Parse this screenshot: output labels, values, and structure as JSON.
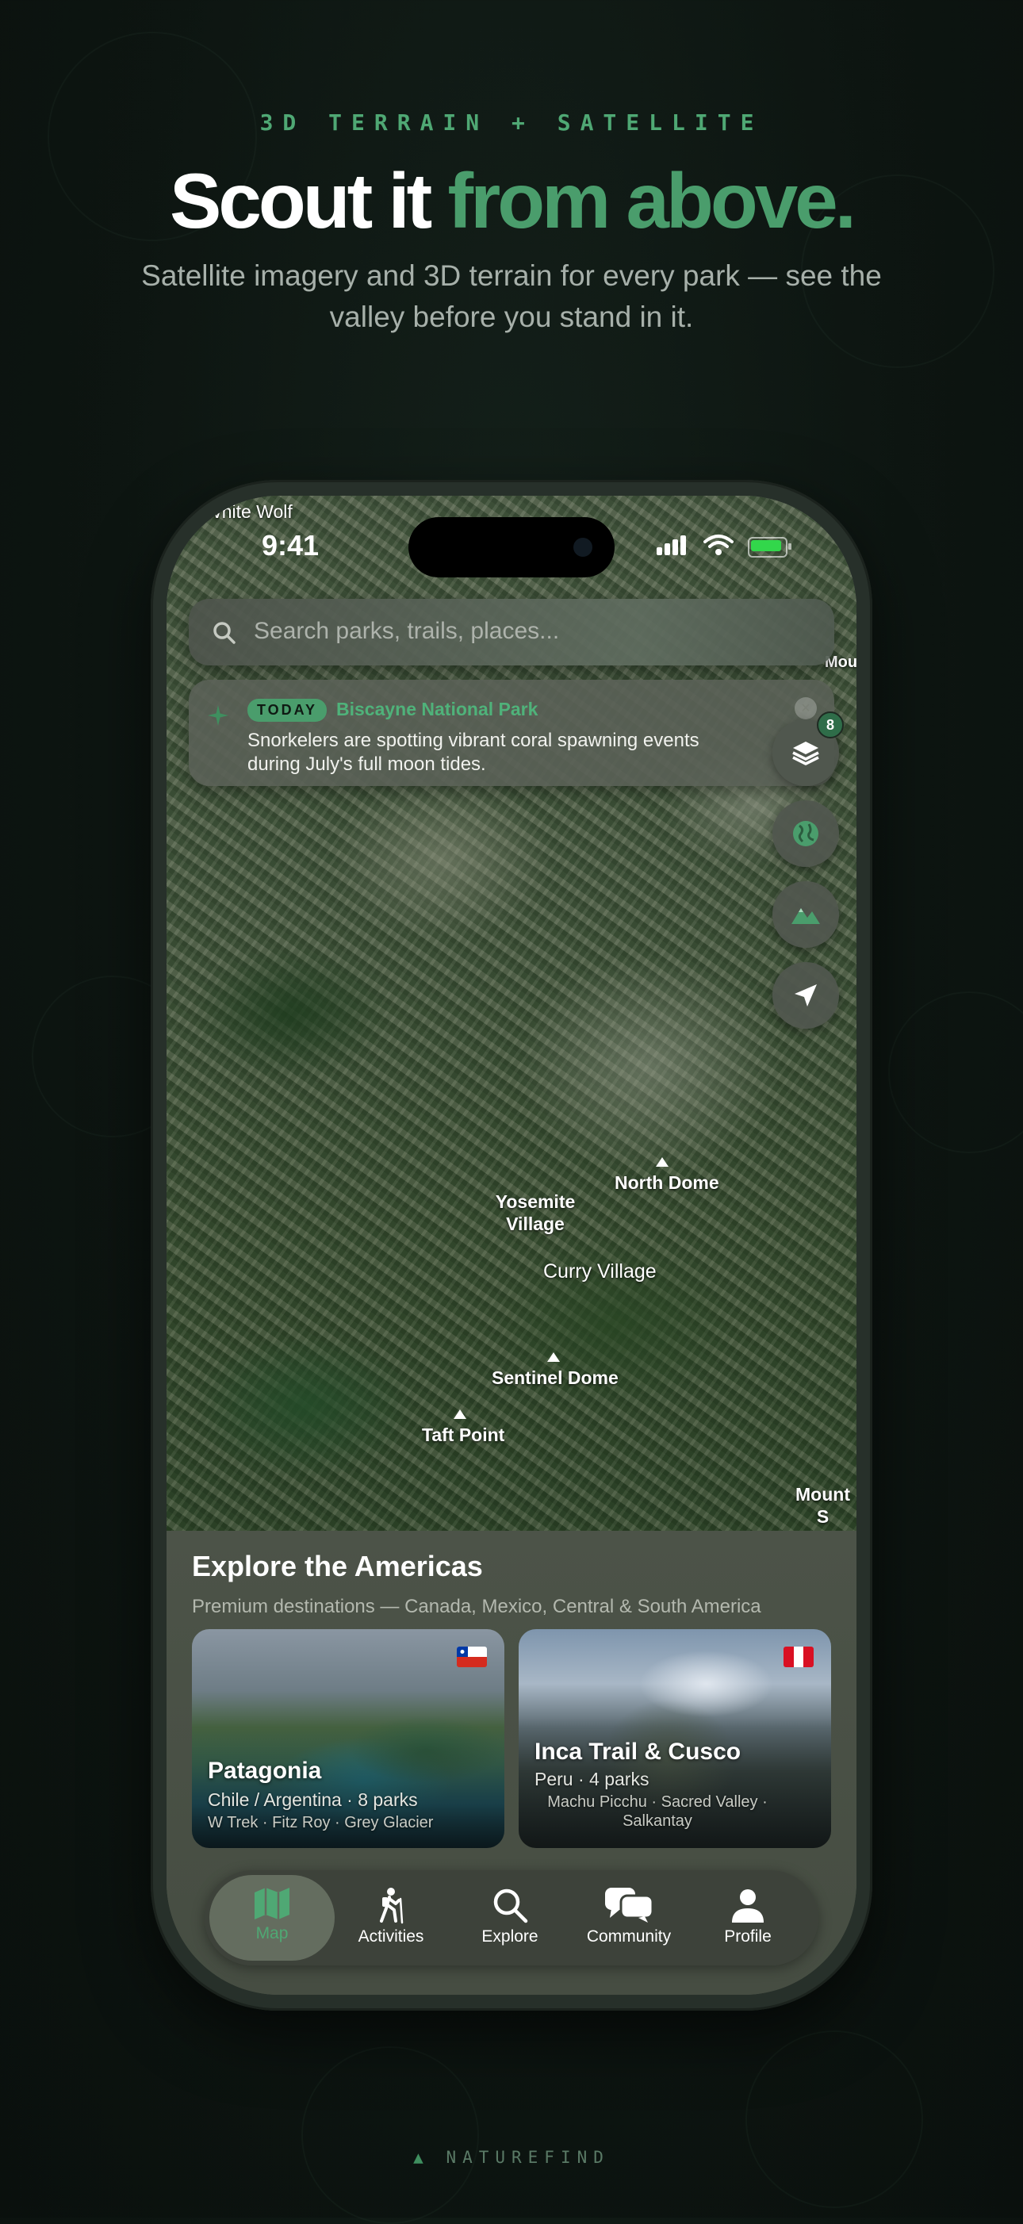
{
  "hero": {
    "eyebrow": "3D TERRAIN + SATELLITE",
    "headline_part1": "Scout it ",
    "headline_part2": "from above.",
    "subhead": "Satellite imagery and 3D terrain for every park — see the valley before you stand in it."
  },
  "status_bar": {
    "time": "9:41",
    "map_corner_label": "White Wolf"
  },
  "search": {
    "placeholder": "Search parks, trails, places..."
  },
  "today_card": {
    "badge": "TODAY",
    "park": "Biscayne National Park",
    "message": "Snorkelers are spotting vibrant coral spawning events during July's full moon tides."
  },
  "map_controls": {
    "layers_count": "8"
  },
  "map_labels": {
    "north_dome": "North Dome",
    "yosemite_village": "Yosemite Village",
    "curry_village": "Curry Village",
    "sentinel_dome": "Sentinel Dome",
    "taft_point": "Taft Point",
    "mount_edge": "Mount S",
    "mount_top_edge": "Mou"
  },
  "explore": {
    "title": "Explore the Americas",
    "description": "Premium destinations — Canada, Mexico, Central & South America",
    "cards": [
      {
        "title": "Patagonia",
        "subtitle": "Chile / Argentina · 8 parks",
        "highlights": "W Trek · Fitz Roy · Grey Glacier",
        "flag": "chile-flag"
      },
      {
        "title": "Inca Trail & Cusco",
        "subtitle": "Peru · 4 parks",
        "highlights": "Machu Picchu · Sacred Valley · Salkantay",
        "flag": "peru-flag"
      }
    ]
  },
  "tabs": [
    {
      "label": "Map",
      "icon": "map-icon",
      "active": true
    },
    {
      "label": "Activities",
      "icon": "hiker-icon",
      "active": false
    },
    {
      "label": "Explore",
      "icon": "search-icon",
      "active": false
    },
    {
      "label": "Community",
      "icon": "chat-bubbles-icon",
      "active": false
    },
    {
      "label": "Profile",
      "icon": "person-icon",
      "active": false
    }
  ],
  "footer": {
    "brand": "NATUREFIND"
  },
  "colors": {
    "accent": "#4a9d6c",
    "background": "#0d1511"
  }
}
